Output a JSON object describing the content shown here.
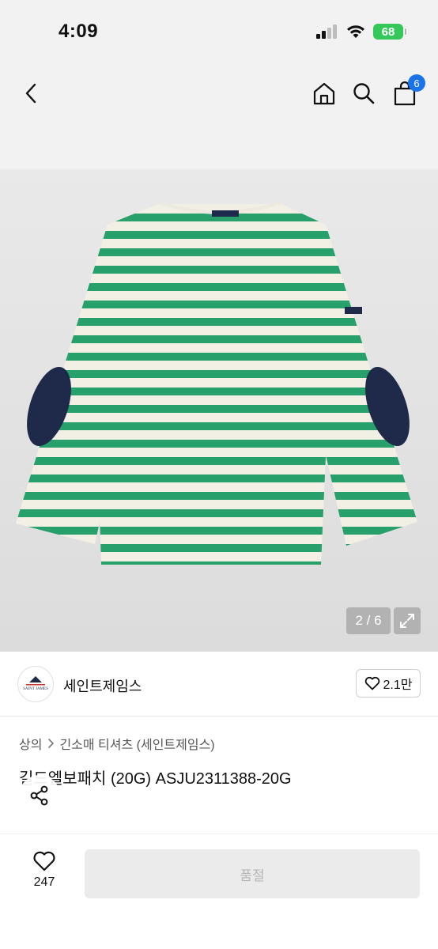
{
  "status": {
    "time": "4:09",
    "battery": "68"
  },
  "nav": {
    "cart_count": "6"
  },
  "gallery": {
    "counter": "2 / 6"
  },
  "brand": {
    "name": "세인트제임스",
    "logo_text": "SAINT JAMES",
    "likes": "2.1만"
  },
  "breadcrumb": {
    "items": [
      "상의",
      "긴소매 티셔츠 (세인트제임스)"
    ]
  },
  "product": {
    "title": "길드엘보패치 (20G) ASJU2311388-20G"
  },
  "bottom": {
    "wish_count": "247",
    "cta_label": "품절"
  },
  "colors": {
    "stripe_green": "#27a06b",
    "stripe_cream": "#f2f0e4",
    "patch_navy": "#1f2a4a",
    "badge_blue": "#1a73e8",
    "battery_green": "#34c759"
  }
}
